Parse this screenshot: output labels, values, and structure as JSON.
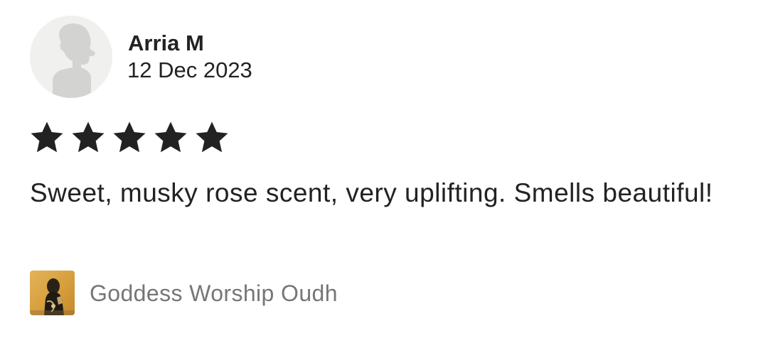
{
  "reviewer": {
    "name": "Arria M",
    "date": "12 Dec 2023",
    "avatar_icon": "default-user-silhouette-icon"
  },
  "rating": {
    "value": 5,
    "max": 5,
    "star_color": "#222222",
    "star_icon": "star-icon"
  },
  "review": {
    "text": "Sweet, musky rose scent, very uplifting. Smells beautiful!"
  },
  "product": {
    "name": "Goddess Worship Oudh",
    "name_color": "#767676"
  }
}
